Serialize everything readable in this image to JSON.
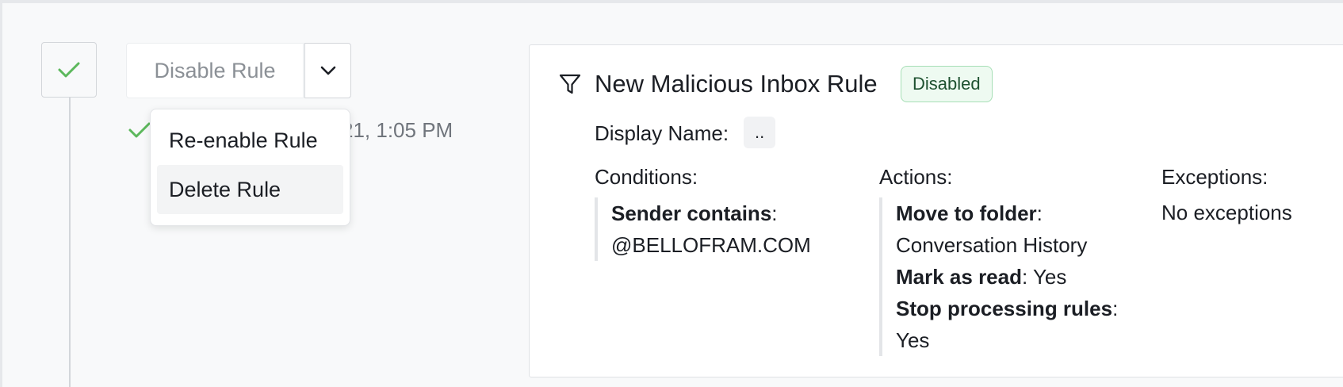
{
  "step": {
    "check_icon": "check-icon",
    "accent": "#5cb85c"
  },
  "split_button": {
    "label": "Disable Rule",
    "chevron_icon": "chevron-down-icon"
  },
  "status": {
    "time_text": "21, 1:05 PM"
  },
  "menu": {
    "items": [
      {
        "label": "Re-enable Rule"
      },
      {
        "label": "Delete Rule"
      }
    ]
  },
  "rule": {
    "icon": "filter-icon",
    "title": "New Malicious Inbox Rule",
    "badge": "Disabled",
    "display_name_label": "Display Name:",
    "display_name_value": "..",
    "conditions": {
      "heading": "Conditions:",
      "items": [
        {
          "key": "Sender contains",
          "value": "@BELLOFRAM.COM"
        }
      ]
    },
    "actions": {
      "heading": "Actions:",
      "items": [
        {
          "key": "Move to folder",
          "value": "Conversation History"
        },
        {
          "key": "Mark as read",
          "value": "Yes"
        },
        {
          "key": "Stop processing rules",
          "value": "Yes"
        }
      ]
    },
    "exceptions": {
      "heading": "Exceptions:",
      "text": "No exceptions"
    }
  }
}
